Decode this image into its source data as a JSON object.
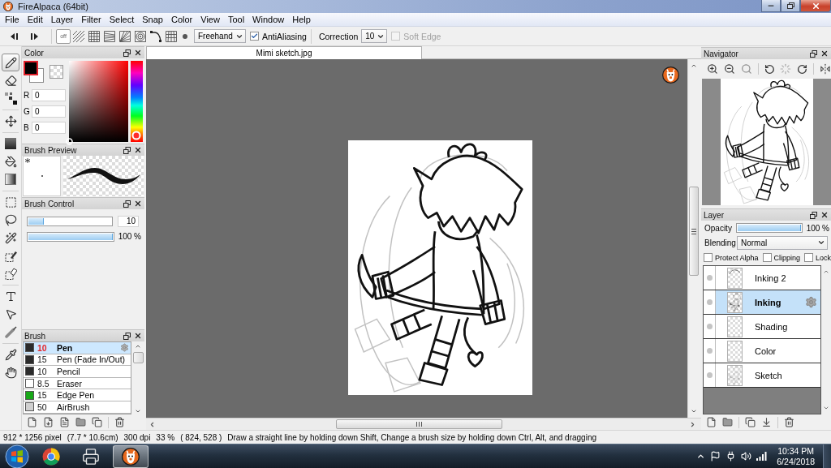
{
  "window": {
    "title": "FireAlpaca (64bit)"
  },
  "menu": [
    "File",
    "Edit",
    "Layer",
    "Filter",
    "Select",
    "Snap",
    "Color",
    "View",
    "Tool",
    "Window",
    "Help"
  ],
  "toolbar": {
    "snaps": [
      {
        "kind": "off",
        "label": "off",
        "selected": true
      },
      {
        "kind": "parallel",
        "selected": false
      },
      {
        "kind": "crisscross",
        "selected": false
      },
      {
        "kind": "vanishing",
        "selected": false
      },
      {
        "kind": "radial",
        "selected": false
      },
      {
        "kind": "concentric",
        "selected": false
      },
      {
        "kind": "curve",
        "selected": false
      },
      {
        "kind": "perspective",
        "selected": false
      }
    ],
    "mode": "Freehand",
    "antialiasing": {
      "label": "AntiAliasing",
      "checked": true
    },
    "correction": {
      "label": "Correction",
      "value": "10"
    },
    "soft_edge": {
      "label": "Soft Edge",
      "checked": false,
      "disabled": true
    }
  },
  "tool_groups": [
    {
      "tools": [
        {
          "kind": "pen",
          "selected": true
        },
        {
          "kind": "eraser",
          "selected": false
        },
        {
          "kind": "dot",
          "selected": false
        }
      ]
    },
    {
      "tools": [
        {
          "kind": "move",
          "selected": false
        }
      ]
    },
    {
      "tools": [
        {
          "kind": "fill",
          "selected": false
        },
        {
          "kind": "bucket",
          "selected": false
        },
        {
          "kind": "gradient",
          "selected": false
        }
      ]
    },
    {
      "tools": [
        {
          "kind": "select",
          "selected": false
        },
        {
          "kind": "lasso",
          "selected": false
        },
        {
          "kind": "wand",
          "selected": false
        },
        {
          "kind": "select-pen",
          "selected": false
        },
        {
          "kind": "select-eraser",
          "selected": false
        }
      ]
    },
    {
      "tools": [
        {
          "kind": "text",
          "selected": false
        },
        {
          "kind": "operation",
          "selected": false
        },
        {
          "kind": "blur",
          "selected": false
        }
      ]
    },
    {
      "tools": [
        {
          "kind": "eyedropper",
          "selected": false
        },
        {
          "kind": "hand",
          "selected": false
        }
      ]
    }
  ],
  "color_panel": {
    "title": "Color",
    "channels": [
      {
        "label": "R",
        "value": "0"
      },
      {
        "label": "G",
        "value": "0"
      },
      {
        "label": "B",
        "value": "0"
      }
    ],
    "hue": {
      "level": 0
    }
  },
  "brush_preview": {
    "title": "Brush Preview"
  },
  "brush_control": {
    "title": "Brush Control",
    "size": {
      "level": 0.19,
      "value": "10"
    },
    "opacity": {
      "level": 1,
      "value": "100 %"
    }
  },
  "brush_panel": {
    "title": "Brush",
    "brushes": [
      {
        "size": "10",
        "name": "Pen",
        "color": "#2b2b2b",
        "selected": true
      },
      {
        "size": "15",
        "name": "Pen (Fade In/Out)",
        "color": "#2b2b2b",
        "selected": false
      },
      {
        "size": "10",
        "name": "Pencil",
        "color": "#2b2b2b",
        "selected": false
      },
      {
        "size": "8.5",
        "name": "Eraser",
        "color": "#ffffff",
        "selected": false
      },
      {
        "size": "15",
        "name": "Edge Pen",
        "color": "#18a818",
        "selected": false
      },
      {
        "size": "50",
        "name": "AirBrush",
        "color": "#d0d0d0",
        "selected": false
      }
    ]
  },
  "document": {
    "tab": "Mimi sketch.jpg"
  },
  "navigator": {
    "title": "Navigator"
  },
  "layer_panel": {
    "title": "Layer",
    "opacity": {
      "label": "Opacity",
      "level": 1,
      "value": "100 %"
    },
    "blending": {
      "label": "Blending",
      "value": "Normal"
    },
    "options": [
      {
        "label": "Protect Alpha",
        "checked": false
      },
      {
        "label": "Clipping",
        "checked": false
      },
      {
        "label": "Lock",
        "checked": false
      }
    ],
    "layers": [
      {
        "name": "Inking 2",
        "kind": "partial",
        "selected": false
      },
      {
        "name": "Inking",
        "kind": "lines",
        "selected": true
      },
      {
        "name": "Shading",
        "kind": "empty",
        "selected": false
      },
      {
        "name": "Color",
        "kind": "empty",
        "selected": false
      },
      {
        "name": "Sketch",
        "kind": "faint",
        "selected": false
      }
    ]
  },
  "status_bar": {
    "pixels": "912 * 1256 pixel",
    "physical": "(7.7 * 10.6cm)",
    "dpi": "300 dpi",
    "zoom": "33 %",
    "cursor": "( 824, 528 )",
    "hint": "Draw a straight line by holding down Shift, Change a brush size by holding down Ctrl, Alt, and dragging"
  },
  "taskbar": {
    "apps": [
      {
        "kind": "browser",
        "selected": false
      },
      {
        "kind": "printer",
        "selected": false
      },
      {
        "kind": "alpaca",
        "selected": true
      }
    ],
    "time": "10:34 PM",
    "date": "6/24/2018"
  }
}
